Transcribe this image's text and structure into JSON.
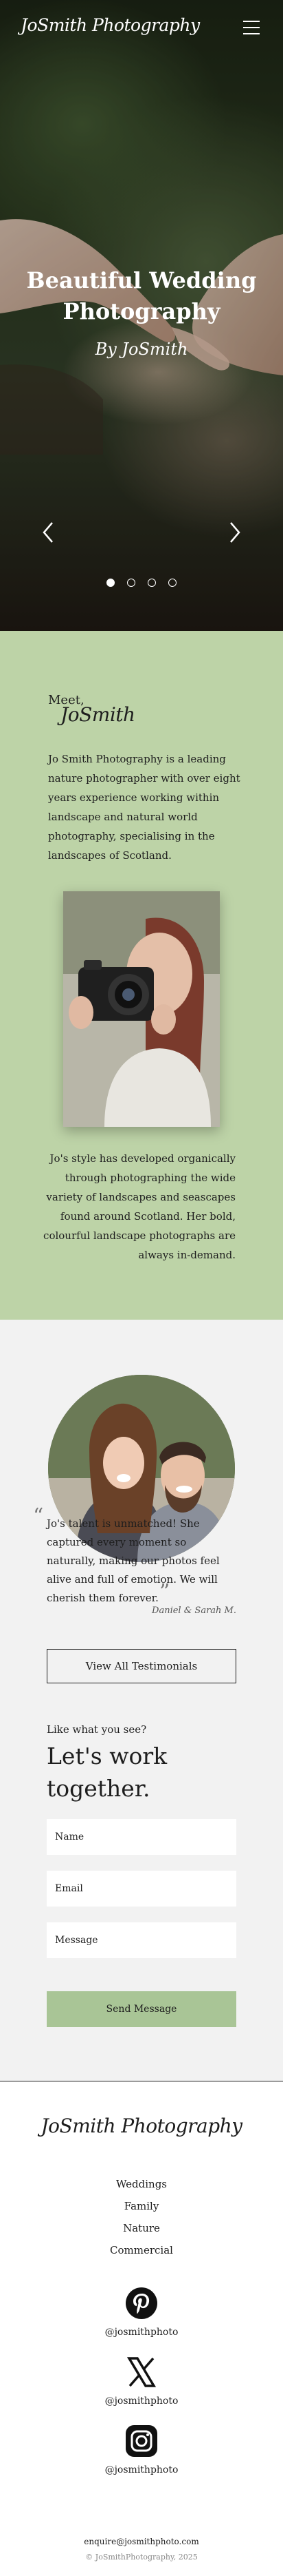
{
  "brand": {
    "logo_text": "JoSmith Photography"
  },
  "hero": {
    "title": "Beautiful Wedding Photography",
    "subtitle": "By JoSmith",
    "slides": [
      {
        "active": true
      },
      {
        "active": false
      },
      {
        "active": false
      },
      {
        "active": false
      }
    ]
  },
  "about": {
    "meet_label": "Meet,",
    "name": "JoSmith",
    "intro": "Jo Smith Photography is a leading nature photographer with over eight years experience working within landscape and natural world photography, specialising in the landscapes of Scotland.",
    "style": "Jo's style has developed organically through photographing the wide variety of landscapes and seascapes found around Scotland. Her bold, colourful landscape photographs are always in-demand.",
    "background_color": "#bdd3a7"
  },
  "testimonial": {
    "quote": "Jo's talent is unmatched! She captured every moment so naturally, making our photos feel alive and full of emotion. We will cherish them forever.",
    "author": "Daniel & Sarah M.",
    "button_label": "View All Testimonials"
  },
  "contact": {
    "small_heading": "Like what you see?",
    "heading": "Let's work together.",
    "fields": {
      "name": "Name",
      "email": "Email",
      "message": "Message"
    },
    "submit_label": "Send Message",
    "accent_color": "#a9c596"
  },
  "footer": {
    "logo_text": "JoSmith Photography",
    "nav": [
      "Weddings",
      "Family",
      "Nature",
      "Commercial"
    ],
    "socials": [
      {
        "icon": "pinterest-icon",
        "handle": "@josmithphoto"
      },
      {
        "icon": "x-icon",
        "handle": "@josmithphoto"
      },
      {
        "icon": "instagram-icon",
        "handle": "@josmithphoto"
      }
    ],
    "email": "enquire@josmithphoto.com",
    "copyright": "© JoSmithPhotography, 2025"
  }
}
